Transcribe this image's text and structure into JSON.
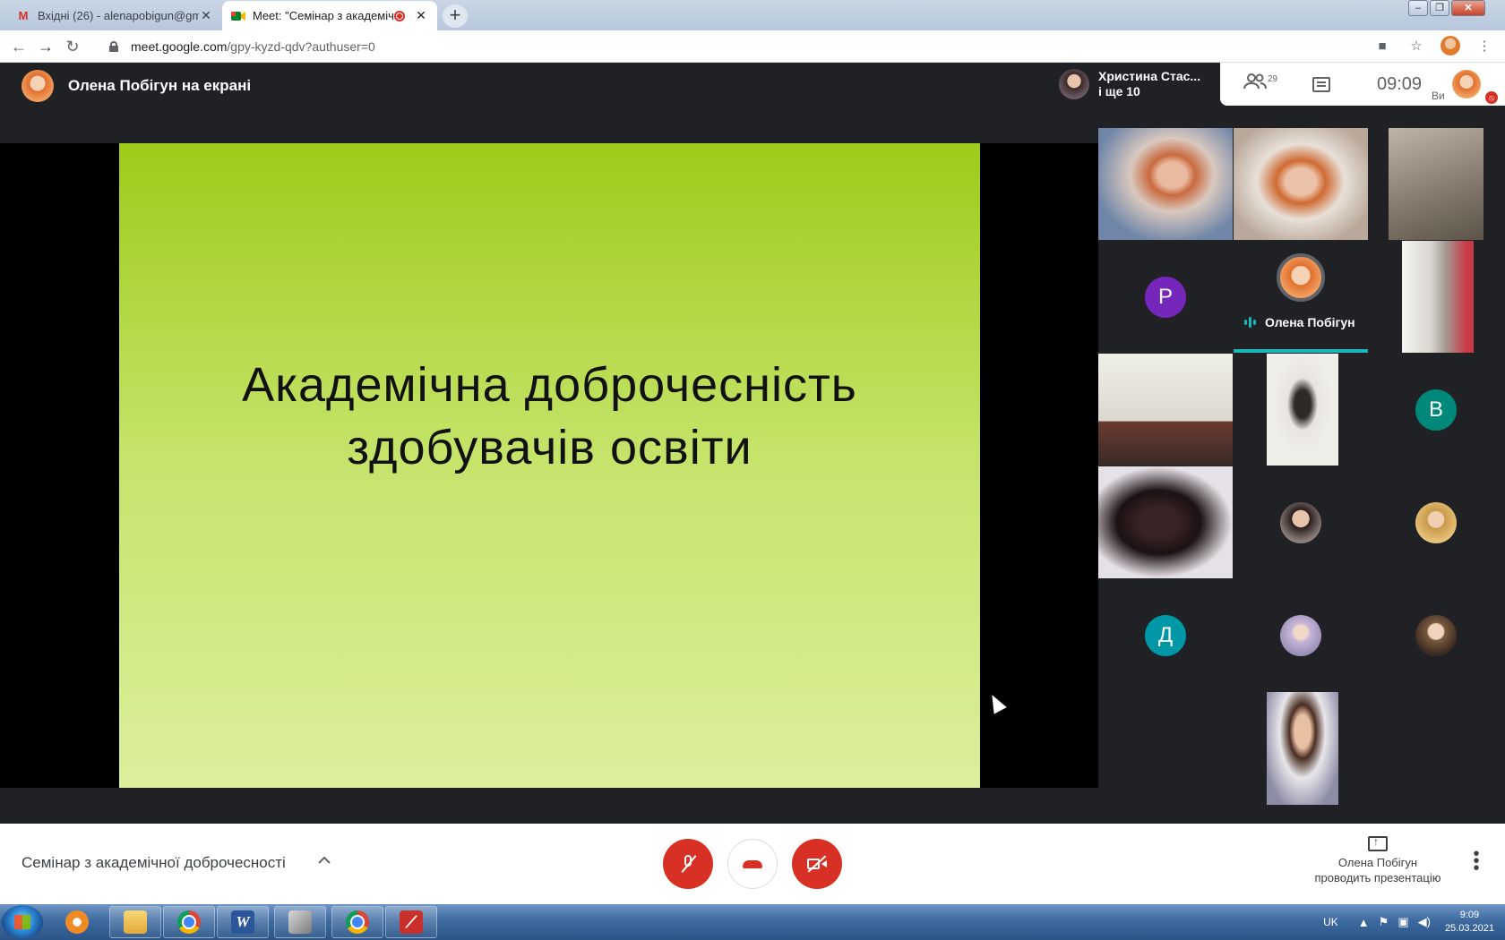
{
  "browser": {
    "tabs": [
      {
        "label": "Вхідні (26) - alenapobigun@gma",
        "favicon": "gmail-icon",
        "active": false
      },
      {
        "label": "Meet: \"Семінар з академічн",
        "favicon": "meet-icon",
        "active": true,
        "recording": true
      }
    ],
    "new_tab": "+",
    "address": {
      "host": "meet.google.com",
      "path": "/gpy-kyzd-qdv?authuser=0"
    }
  },
  "meet": {
    "presenter_banner": "Олена Побігун на екрані",
    "active_speaker": {
      "line1": "Христина Стас...",
      "line2": "і ще 10"
    },
    "participants_count": "29",
    "time": "09:09",
    "you_label": "Ви",
    "slide": {
      "line1": "Академічна доброчесність",
      "line2": "здобувачів освіти"
    },
    "grid": {
      "letters": {
        "r": "Р",
        "v": "В",
        "d": "Д"
      },
      "speaker_name": "Олена Побігун"
    },
    "meeting_title": "Семінар з академічної доброчесності",
    "presenting": {
      "line1": "Олена Побігун",
      "line2": "проводить презентацію"
    }
  },
  "colors": {
    "accent_teal": "#1ab6ba",
    "danger_red": "#d93025",
    "meet_dark": "#202124"
  },
  "taskbar": {
    "lang": "UK",
    "time": "9:09",
    "date": "25.03.2021"
  }
}
